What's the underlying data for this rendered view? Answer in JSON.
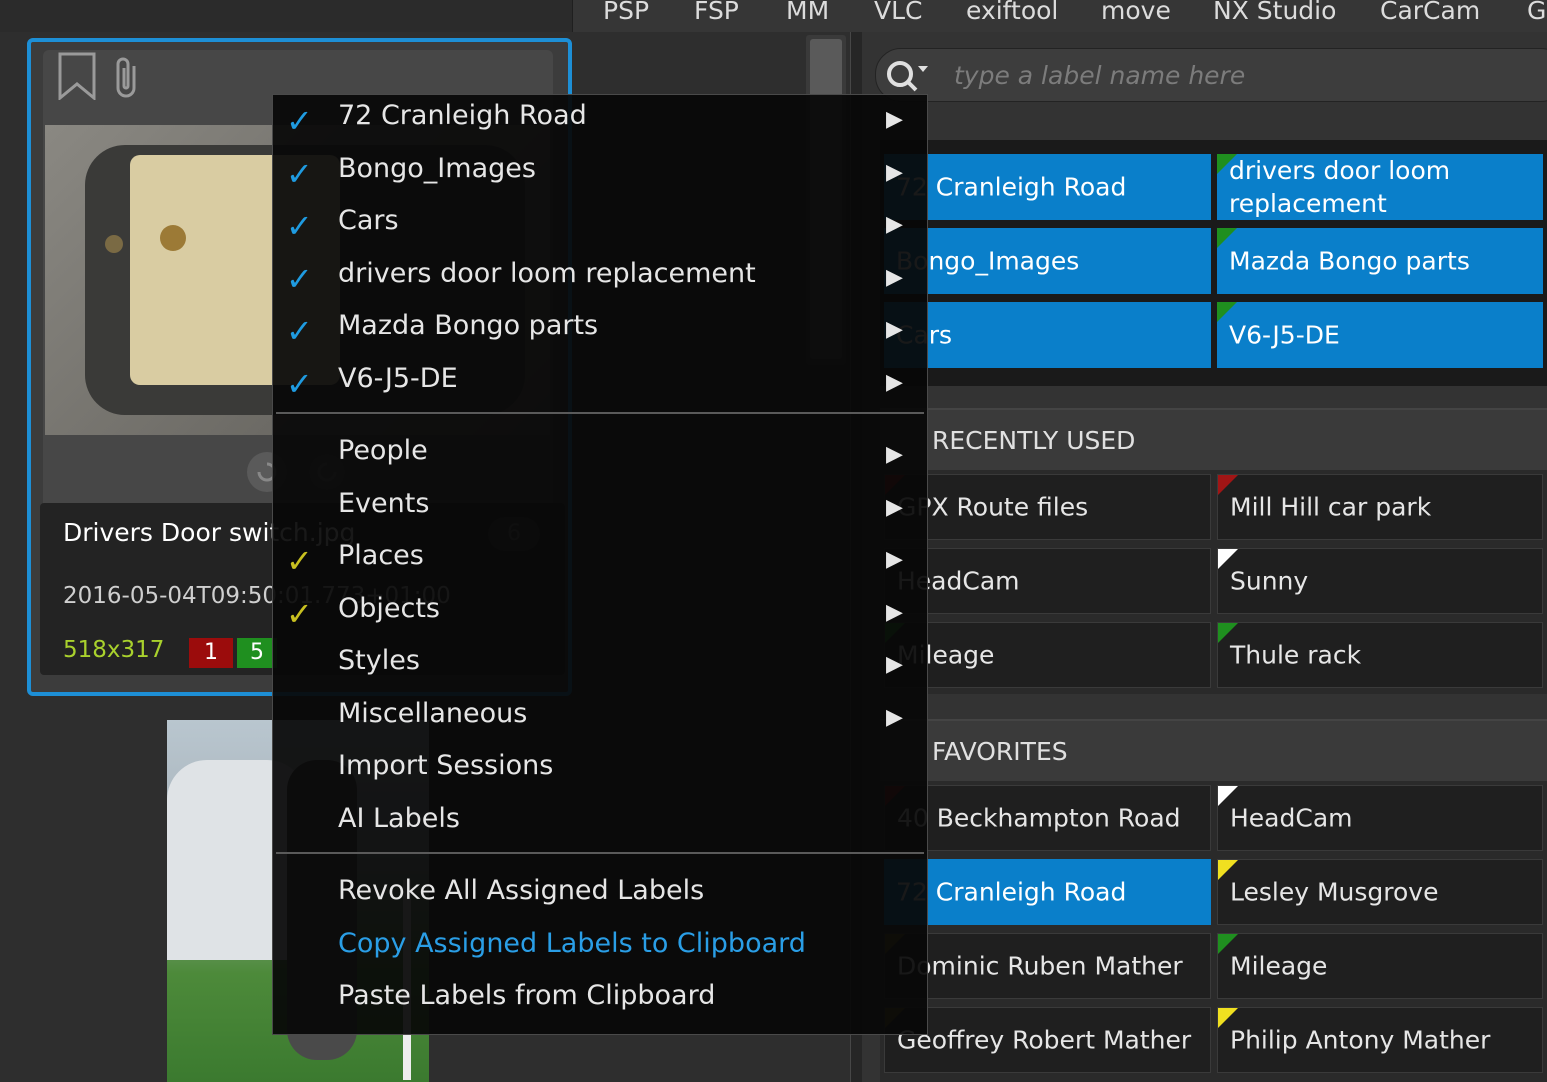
{
  "toolbar": {
    "items": [
      "PSP",
      "FSP",
      "MM",
      "VLC",
      "exiftool",
      "move",
      "NX Studio",
      "CarCam",
      "G"
    ]
  },
  "thumbnail": {
    "filename": "Drivers Door switch.jpg",
    "datetime": "2016-05-04T09:50:01.773+01:00",
    "dimensions": "518x317",
    "badge_red": "1",
    "badge_green": "5",
    "label_count": "6"
  },
  "search": {
    "placeholder": "type a label name here"
  },
  "assigned_labels": [
    "72 Cranleigh Road",
    "drivers door loom replacement",
    "Bongo_Images",
    "Mazda Bongo parts",
    "Cars",
    "V6-J5-DE"
  ],
  "recently_used": {
    "title": "RECENTLY USED",
    "items": [
      "GPX Route files",
      "Mill Hill car park",
      "HeadCam",
      "Sunny",
      "Mileage",
      "Thule rack"
    ]
  },
  "favorites": {
    "title": "FAVORITES",
    "items": [
      "40 Beckhampton Road",
      "HeadCam",
      "72 Cranleigh Road",
      "Lesley Musgrove",
      "Dominic Ruben Mather",
      "Mileage",
      "Geoffrey Robert Mather",
      "Philip Antony Mather"
    ]
  },
  "context_menu": {
    "assigned": [
      "72 Cranleigh Road",
      "Bongo_Images",
      "Cars",
      "drivers door loom replacement",
      "Mazda Bongo parts",
      "V6-J5-DE"
    ],
    "categories": [
      "People",
      "Events",
      "Places",
      "Objects",
      "Styles",
      "Miscellaneous",
      "Import Sessions",
      "AI Labels"
    ],
    "actions": [
      "Revoke All Assigned Labels",
      "Copy Assigned Labels to Clipboard",
      "Paste Labels from Clipboard"
    ]
  },
  "colors": {
    "accent": "#0a7fca",
    "selection_border": "#1d8fd6",
    "check_blue": "#1f9be0",
    "check_yellow": "#c8c020",
    "link": "#2a9ee6"
  }
}
